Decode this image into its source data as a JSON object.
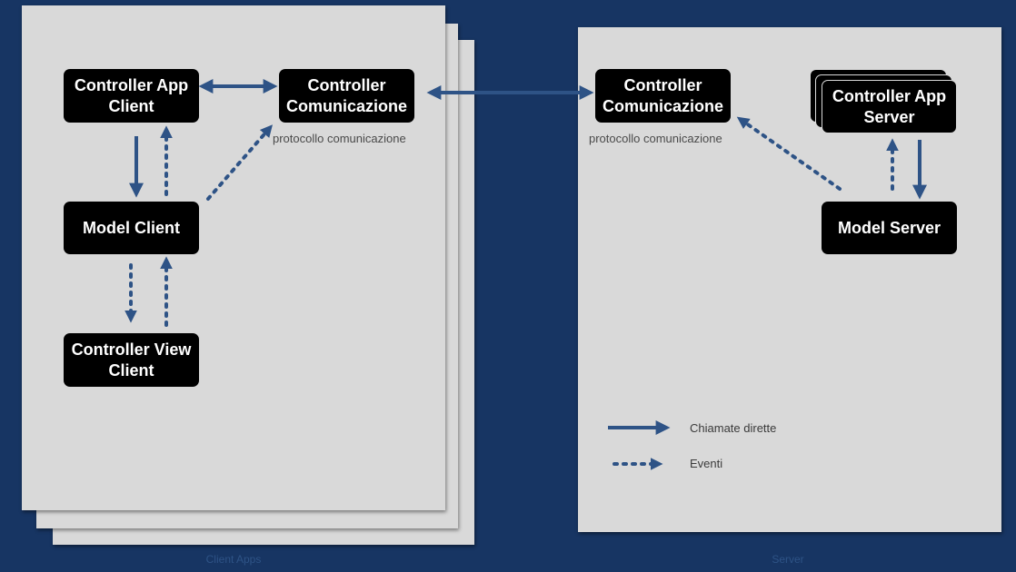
{
  "regions": {
    "client": "Client Apps",
    "server": "Server"
  },
  "nodes": {
    "controller_app_client": "Controller App\nClient",
    "controller_comunicazione_client": "Controller\nComunicazione",
    "model_client": "Model Client",
    "controller_view_client": "Controller View\nClient",
    "controller_comunicazione_server": "Controller\nComunicazione",
    "controller_app_server": "Controller App\nServer",
    "model_server": "Model Server"
  },
  "captions": {
    "protocol_client": "protocollo comunicazione",
    "protocol_server": "protocollo comunicazione"
  },
  "legend": {
    "direct": "Chiamate dirette",
    "events": "Eventi"
  },
  "colors": {
    "background": "#173563",
    "panel": "#d9d9d9",
    "node": "#000000",
    "arrow": "#2e5386"
  }
}
